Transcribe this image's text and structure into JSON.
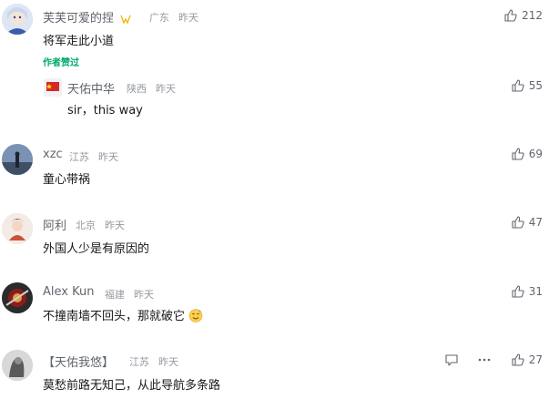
{
  "comments": [
    {
      "username": "芙芙可爱的捏",
      "location": "广东",
      "time": "昨天",
      "text": "将军走此小道",
      "likes": "212",
      "author_liked": "作者赞过",
      "reply": {
        "username": "天佑中华",
        "location": "陕西",
        "time": "昨天",
        "text": "sir，this way",
        "likes": "55"
      }
    },
    {
      "username": "xzc",
      "location": "江苏",
      "time": "昨天",
      "text": "童心带祸",
      "likes": "69"
    },
    {
      "username": "阿利",
      "location": "北京",
      "time": "昨天",
      "text": "外国人少是有原因的",
      "likes": "47"
    },
    {
      "username": "Alex Kun",
      "location": "福建",
      "time": "昨天",
      "text": "不撞南墙不回头，那就破它",
      "likes": "31"
    },
    {
      "username": "【天佑我悠】",
      "location": "江苏",
      "time": "昨天",
      "text": "莫愁前路无知己，从此导航多条路",
      "likes": "27"
    }
  ],
  "icons": {
    "like": "thumb-up-icon",
    "reply": "comment-icon",
    "more": "more-icon",
    "emoji": "sweat-smile-emoji"
  },
  "colors": {
    "author_liked": "#00aa6c",
    "meta": "#9499a0",
    "name": "#61666d"
  }
}
